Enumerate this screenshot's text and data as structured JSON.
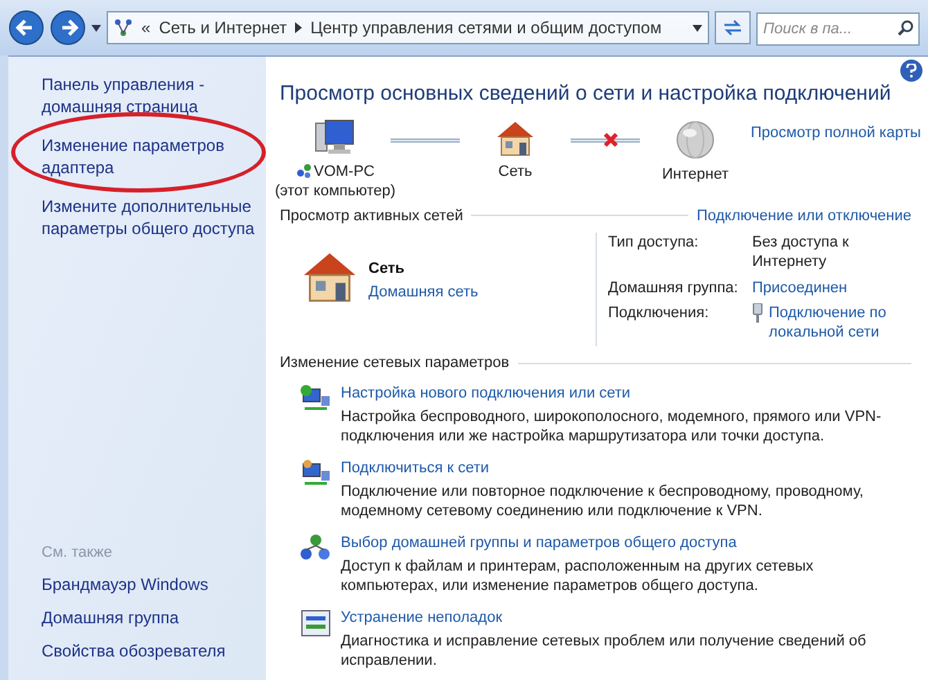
{
  "address_bar": {
    "prefix": "«",
    "crumbs": [
      "Сеть и Интернет",
      "Центр управления сетями и общим доступом"
    ]
  },
  "search": {
    "placeholder": "Поиск в па..."
  },
  "sidebar": {
    "items": [
      {
        "label": "Панель управления - домашняя страница",
        "circled": false
      },
      {
        "label": "Изменение параметров адаптера",
        "circled": true
      },
      {
        "label": "Измените дополнительные параметры общего доступа",
        "circled": false
      }
    ],
    "see_also": {
      "heading": "См. также",
      "items": [
        "Брандмауэр Windows",
        "Домашняя группа",
        "Свойства обозревателя"
      ]
    }
  },
  "main": {
    "title": "Просмотр основных сведений о сети и настройка подключений",
    "full_map_link": "Просмотр полной карты",
    "map": [
      {
        "kind": "computer",
        "label": "VOM-PC",
        "sublabel": "(этот компьютер)",
        "link_broken": false
      },
      {
        "kind": "house",
        "label": "Сеть",
        "link_broken": true
      },
      {
        "kind": "globe",
        "label": "Интернет"
      }
    ],
    "active_networks": {
      "heading": "Просмотр активных сетей",
      "link": "Подключение или отключение",
      "network_name": "Сеть",
      "network_type": "Домашняя сеть",
      "properties": [
        {
          "label": "Тип доступа:",
          "value": "Без доступа к Интернету",
          "kind": "text"
        },
        {
          "label": "Домашняя группа:",
          "value": "Присоединен",
          "kind": "link"
        },
        {
          "label": "Подключения:",
          "value": "Подключение по локальной сети",
          "kind": "adapter-link"
        }
      ]
    },
    "settings": {
      "heading": "Изменение сетевых параметров",
      "items": [
        {
          "kind": "new-connection",
          "title": "Настройка нового подключения или сети",
          "description": "Настройка беспроводного, широкополосного, модемного, прямого или VPN-подключения или же настройка маршрутизатора или точки доступа."
        },
        {
          "kind": "connect",
          "title": "Подключиться к сети",
          "description": "Подключение или повторное подключение к беспроводному, проводному, модемному сетевому соединению или подключение к VPN."
        },
        {
          "kind": "homegroup",
          "title": "Выбор домашней группы и параметров общего доступа",
          "description": "Доступ к файлам и принтерам, расположенным на других сетевых компьютерах, или изменение параметров общего доступа."
        },
        {
          "kind": "troubleshoot",
          "title": "Устранение неполадок",
          "description": "Диагностика и исправление сетевых проблем или получение сведений об исправлении."
        }
      ]
    }
  }
}
